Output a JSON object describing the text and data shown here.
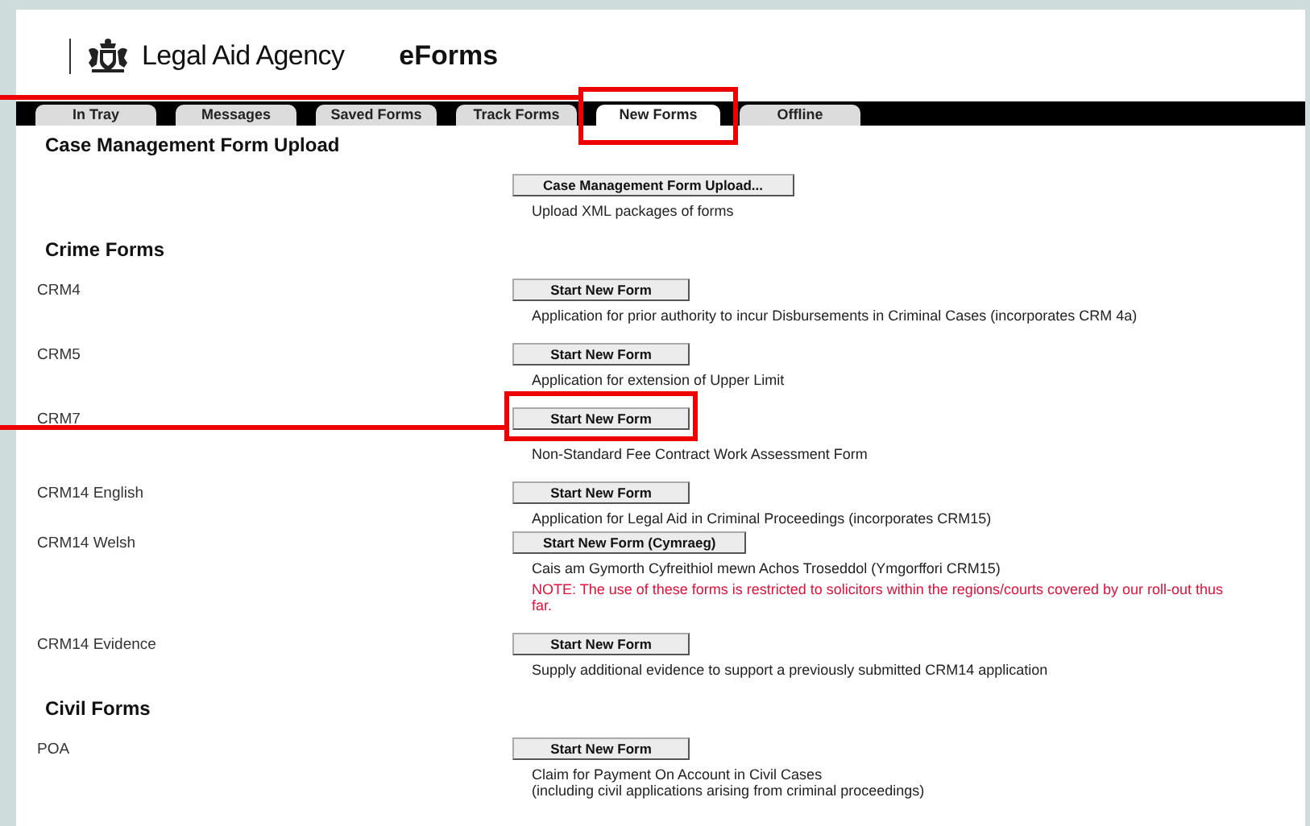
{
  "header": {
    "agency": "Legal Aid Agency",
    "app": "eForms"
  },
  "tabs": [
    {
      "label": "In Tray",
      "selected": false,
      "highlighted": false
    },
    {
      "label": "Messages",
      "selected": false,
      "highlighted": false
    },
    {
      "label": "Saved Forms",
      "selected": false,
      "highlighted": false
    },
    {
      "label": "Track Forms",
      "selected": false,
      "highlighted": false
    },
    {
      "label": "New Forms",
      "selected": true,
      "highlighted": true
    },
    {
      "label": "Offline",
      "selected": false,
      "highlighted": false
    }
  ],
  "sections": [
    {
      "heading": "Case Management Form Upload",
      "forms": [
        {
          "button": "Case Management Form Upload...",
          "description": [
            "Upload XML packages of forms"
          ],
          "highlighted": false
        }
      ]
    },
    {
      "heading": "Crime Forms",
      "forms": [
        {
          "name": "CRM4",
          "button": "Start New Form",
          "description": [
            "Application for prior authority to incur Disbursements in Criminal Cases (incorporates CRM 4a)"
          ],
          "highlighted": false
        },
        {
          "name": "CRM5",
          "button": "Start New Form",
          "description": [
            "Application for extension of Upper Limit"
          ],
          "highlighted": false
        },
        {
          "name": "CRM7",
          "button": "Start New Form",
          "description": [
            "Non-Standard Fee Contract Work Assessment Form"
          ],
          "highlighted": true
        },
        {
          "name": "CRM14 English",
          "button": "Start New Form",
          "description": [
            "Application for Legal Aid in Criminal Proceedings (incorporates CRM15)"
          ],
          "highlighted": false,
          "compact": true
        },
        {
          "name": "CRM14 Welsh",
          "button": "Start New Form (Cymraeg)",
          "description": [
            "Cais am Gymorth Cyfreithiol mewn Achos Troseddol (Ymgorffori CRM15)"
          ],
          "note": "NOTE: The use of these forms is restricted to solicitors within the regions/courts covered by our roll-out thus far.",
          "highlighted": false
        },
        {
          "name": "CRM14 Evidence",
          "button": "Start New Form",
          "description": [
            "Supply additional evidence to support a previously submitted CRM14 application"
          ],
          "highlighted": false
        }
      ]
    },
    {
      "heading": "Civil Forms",
      "forms": [
        {
          "name": "POA",
          "button": "Start New Form",
          "description": [
            "Claim for Payment On Account in Civil Cases",
            "(including civil applications arising from criminal proceedings)"
          ],
          "highlighted": false
        }
      ]
    }
  ]
}
